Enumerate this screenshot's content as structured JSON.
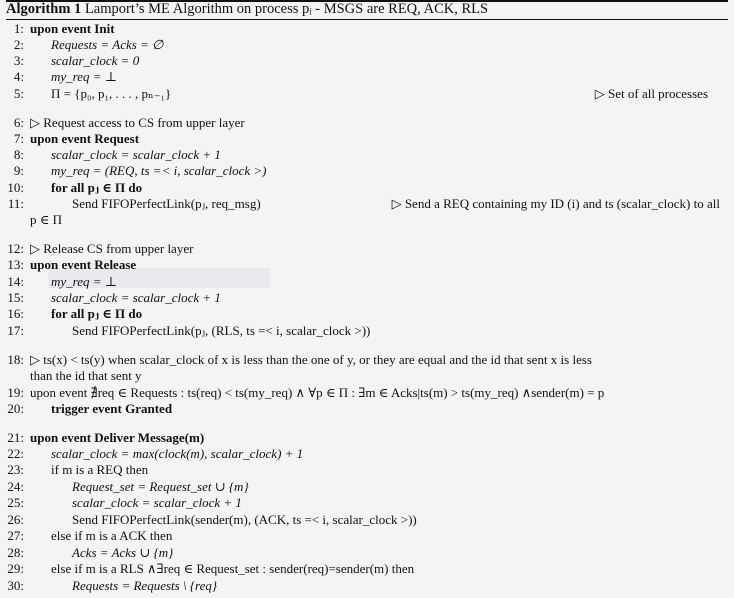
{
  "title": {
    "label": "Algorithm 1",
    "text": "Lamport’s ME Algorithm on process pᵢ - MSGS are REQ, ACK, RLS"
  },
  "lines": [
    {
      "num": "1:",
      "text": "upon event Init"
    },
    {
      "num": "2:",
      "text": "Requests = Acks = ∅"
    },
    {
      "num": "3:",
      "text": "scalar_clock = 0"
    },
    {
      "num": "4:",
      "text": "my_req = ⊥"
    },
    {
      "num": "5:",
      "text": "Π = {p₀, p₁, . . . , pₙ₋₁}",
      "comment": "▷ Set of all processes"
    },
    {
      "num": "6:",
      "text": "▷ Request access to CS from upper layer"
    },
    {
      "num": "7:",
      "text": "upon event Request"
    },
    {
      "num": "8:",
      "text": "scalar_clock = scalar_clock + 1"
    },
    {
      "num": "9:",
      "text": "my_req = (REQ, ts =< i, scalar_clock >)"
    },
    {
      "num": "10:",
      "text": "for all pⱼ ∈ Π do"
    },
    {
      "num": "11:",
      "text": "Send FIFOPerfectLink(pⱼ, req_msg)",
      "comment": "▷ Send a REQ containing my ID (i) and ts (scalar_clock) to all"
    },
    {
      "num": "",
      "text": "p ∈ Π"
    },
    {
      "num": "12:",
      "text": "▷ Release CS from upper layer"
    },
    {
      "num": "13:",
      "text": "upon event Release"
    },
    {
      "num": "14:",
      "text": "my_req = ⊥"
    },
    {
      "num": "15:",
      "text": "scalar_clock = scalar_clock + 1"
    },
    {
      "num": "16:",
      "text": "for all pⱼ ∈ Π do"
    },
    {
      "num": "17:",
      "text": "Send FIFOPerfectLink(pⱼ, (RLS, ts =< i, scalar_clock >))"
    },
    {
      "num": "18:",
      "text": "▷ ts(x) < ts(y) when scalar_clock of x is less than the one of y, or they are equal and the id that sent x is less"
    },
    {
      "num": "",
      "text": "than the id that sent y"
    },
    {
      "num": "19:",
      "text": "upon event ∄req ∈ Requests : ts(req) < ts(my_req) ∧ ∀p ∈ Π : ∃m ∈ Acks|ts(m) > ts(my_req) ∧sender(m) = p"
    },
    {
      "num": "20:",
      "text": "trigger event Granted"
    },
    {
      "num": "21:",
      "text": "upon event Deliver Message(m)"
    },
    {
      "num": "22:",
      "text": "scalar_clock = max(clock(m), scalar_clock) + 1"
    },
    {
      "num": "23:",
      "text": "if m is a REQ then"
    },
    {
      "num": "24:",
      "text": "Request_set = Request_set ∪ {m}"
    },
    {
      "num": "25:",
      "text": "scalar_clock = scalar_clock + 1"
    },
    {
      "num": "26:",
      "text": "Send FIFOPerfectLink(sender(m), (ACK, ts =< i, scalar_clock >))"
    },
    {
      "num": "27:",
      "text": "else if m is a ACK then"
    },
    {
      "num": "28:",
      "text": "Acks = Acks ∪ {m}"
    },
    {
      "num": "29:",
      "text": "else if m is a RLS ∧∃req ∈ Request_set : sender(req)=sender(m) then"
    },
    {
      "num": "30:",
      "text": "Requests = Requests \\ {req}"
    }
  ]
}
